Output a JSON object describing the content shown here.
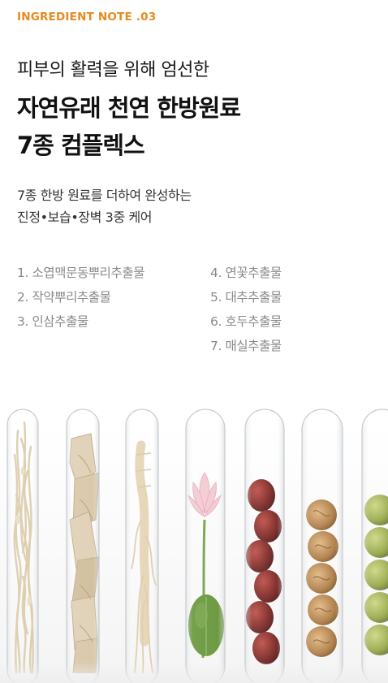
{
  "header": {
    "note_label": "INGREDIENT NOTE .03",
    "subtitle": "피부의 활력을 위해 엄선한",
    "title_line1": "자연유래 천연 한방원료",
    "title_line2": "7종 컴플렉스"
  },
  "description": {
    "line1": "7종 한방 원료를 더하여 완성하는",
    "line2": "진정•보습•장벽 3중 케어"
  },
  "ingredients": [
    "1. 소엽맥문동뿌리추출물",
    "2. 작약뿌리추출물",
    "3. 인삼추출물",
    "4. 연꽃추출물",
    "5. 대추추출물",
    "6. 호두추출물",
    "7. 매실추출물"
  ],
  "colors": {
    "accent": "#e8891d",
    "ingredient_text": "#8a8a8a"
  },
  "image": {
    "subject": "seven glass test tubes with herbal ingredients",
    "tubes": [
      "ophiopogon-root-tube",
      "peony-root-slices-tube",
      "ginseng-tube",
      "lotus-tube",
      "jujube-tube",
      "walnut-tube",
      "plum-tube"
    ]
  }
}
